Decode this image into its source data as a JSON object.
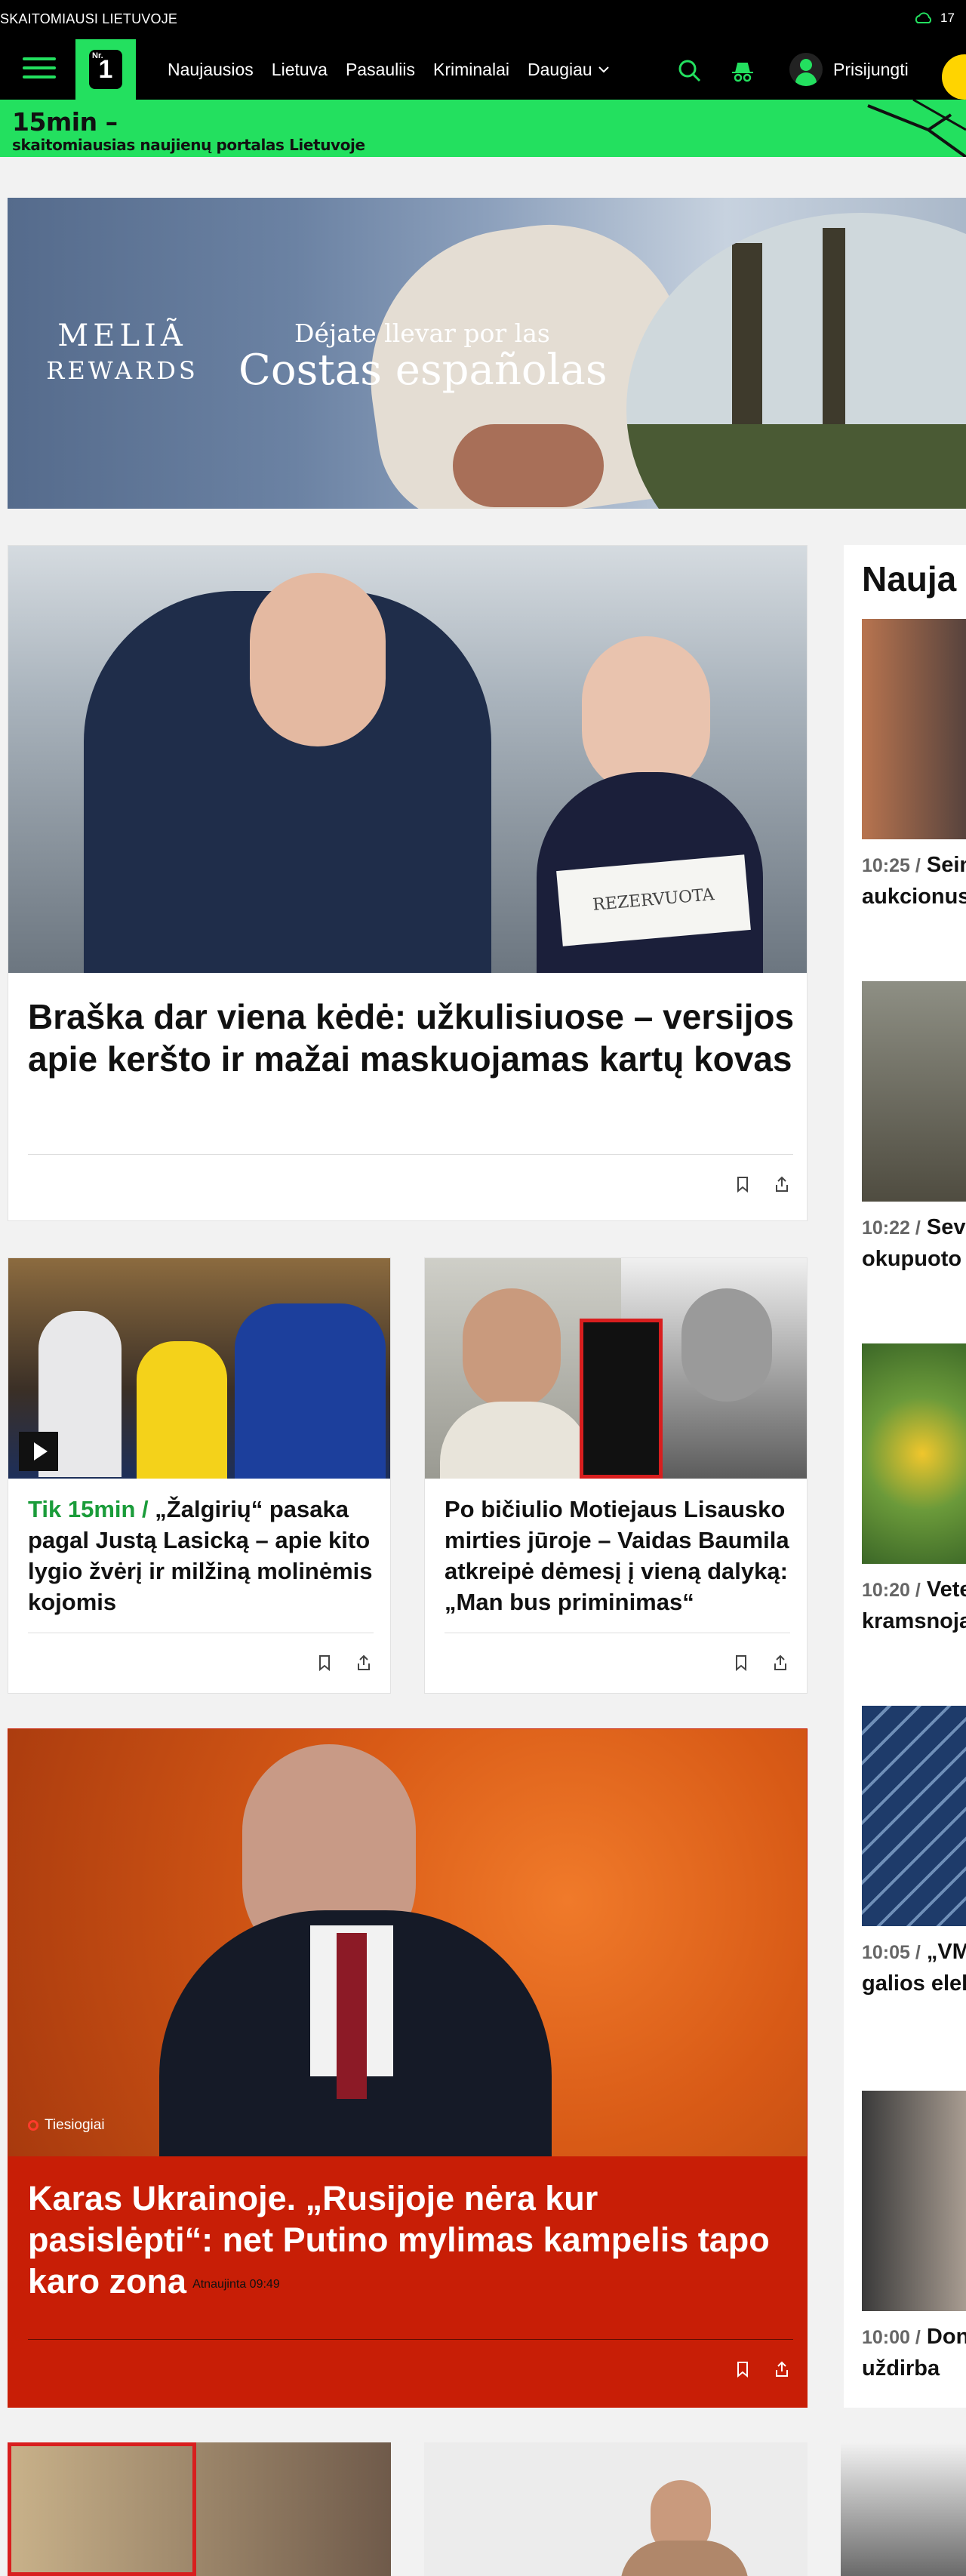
{
  "topbar": {
    "tagline": "SKAITOMIAUSI LIETUVOJE",
    "temperature": "17"
  },
  "nav": {
    "logo_small": "Nr.",
    "logo_big": "1",
    "items": [
      "Naujausios",
      "Lietuva",
      "Pasauliis",
      "Kriminalai"
    ],
    "more": "Daugiau",
    "login": "Prisijungti"
  },
  "banner": {
    "title": "15min –",
    "subtitle": "skaitomiausias naujienų portalas Lietuvoje"
  },
  "ad": {
    "brand_line1": "MELIÃ",
    "brand_line2": "REWARDS",
    "small_text": "Déjate llevar por las",
    "big_text": "Costas españolas"
  },
  "main_article": {
    "title": "Braška dar viena kėdė: užkulisiuose – versijos apie keršto ir mažai maskuojamas kartų kovas",
    "image_label": "REZERVUOTA"
  },
  "card_left": {
    "kicker": "Tik 15min /",
    "title": "„Žalgirių“ pasaka pagal Justą Lasicką – apie kito lygio žvėrį ir milžiną molinėmis kojomis"
  },
  "card_right": {
    "title": "Po bičiulio Motiejaus Lisausko mirties jūroje – Vaidas Baumila atkreipė dėmesį į vieną dalyką: „Man bus priminimas“"
  },
  "live_article": {
    "badge": "Tiesiogiai",
    "title": "Karas Ukrainoje. „Rusijoje nėra kur pasislėpti“: net Putino mylimas kampelis tapo karo zona",
    "updated": "Atnaujinta 09:49"
  },
  "sidebar": {
    "heading": "Nauja",
    "items": [
      {
        "time": "10:25 /",
        "text": "Sein griežtinti v aukcionus"
      },
      {
        "time": "10:22 /",
        "text": "Seva nužudė ke okupuoto"
      },
      {
        "time": "10:20 /",
        "text": "Vete populiarų kramsnoja"
      },
      {
        "time": "10:05 /",
        "text": "„VMC rajone pra galios elel"
      },
      {
        "time": "10:00 /",
        "text": "Don bendrovės uždirba"
      }
    ]
  },
  "colors": {
    "brand_green": "#23e05f",
    "live_red": "#c81e06",
    "accent_yellow": "#ffd400"
  }
}
